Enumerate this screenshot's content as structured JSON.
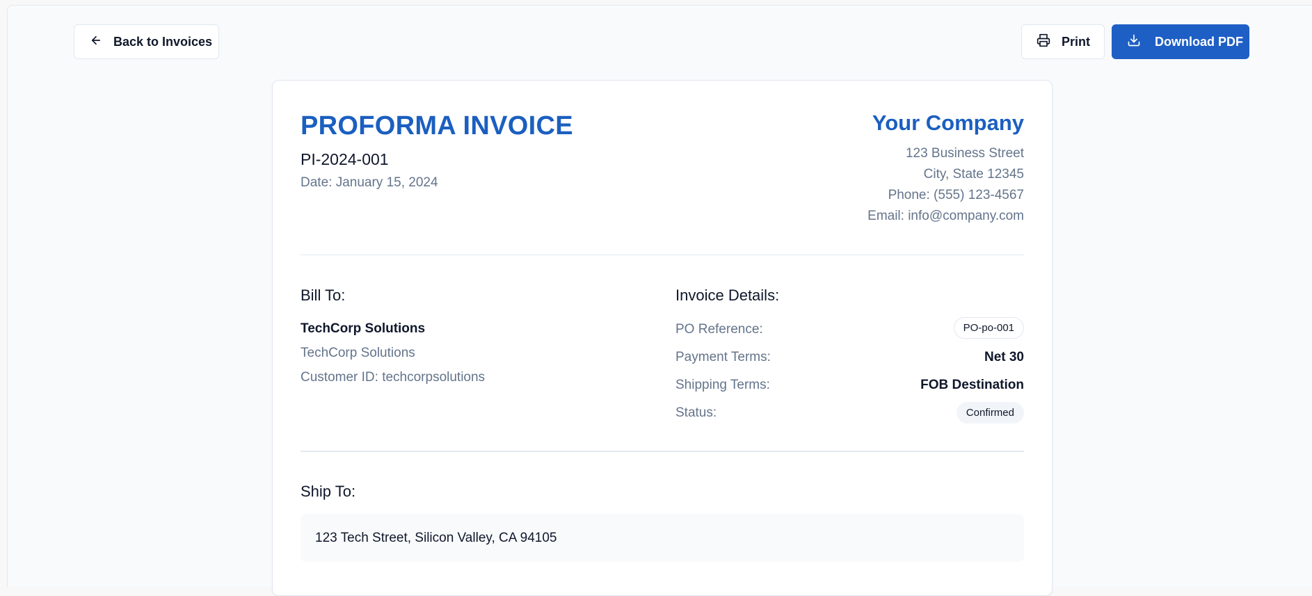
{
  "toolbar": {
    "back_label": "Back to Invoices",
    "print_label": "Print",
    "download_label": "Download PDF"
  },
  "invoice": {
    "title": "PROFORMA INVOICE",
    "number": "PI-2024-001",
    "date": "Date: January 15, 2024"
  },
  "company": {
    "name": "Your Company",
    "address_lines": [
      "123 Business Street",
      "City, State 12345",
      "Phone: (555) 123-4567",
      "Email: info@company.com"
    ]
  },
  "bill_to": {
    "heading": "Bill To:",
    "name": "TechCorp Solutions",
    "company": "TechCorp Solutions",
    "customer_id": "Customer ID: techcorpsolutions"
  },
  "details": {
    "heading": "Invoice Details:",
    "po_label": "PO Reference:",
    "po_value": "PO-po-001",
    "payment_label": "Payment Terms:",
    "payment_value": "Net 30",
    "shipping_label": "Shipping Terms:",
    "shipping_value": "FOB Destination",
    "status_label": "Status:",
    "status_value": "Confirmed"
  },
  "ship_to": {
    "heading": "Ship To:",
    "address": "123 Tech Street, Silicon Valley, CA 94105"
  },
  "colors": {
    "accent": "#1e5fc5",
    "muted_text": "#64748b",
    "border": "#e2e8f0"
  },
  "icons": [
    "arrow-left-icon",
    "printer-icon",
    "download-icon"
  ]
}
